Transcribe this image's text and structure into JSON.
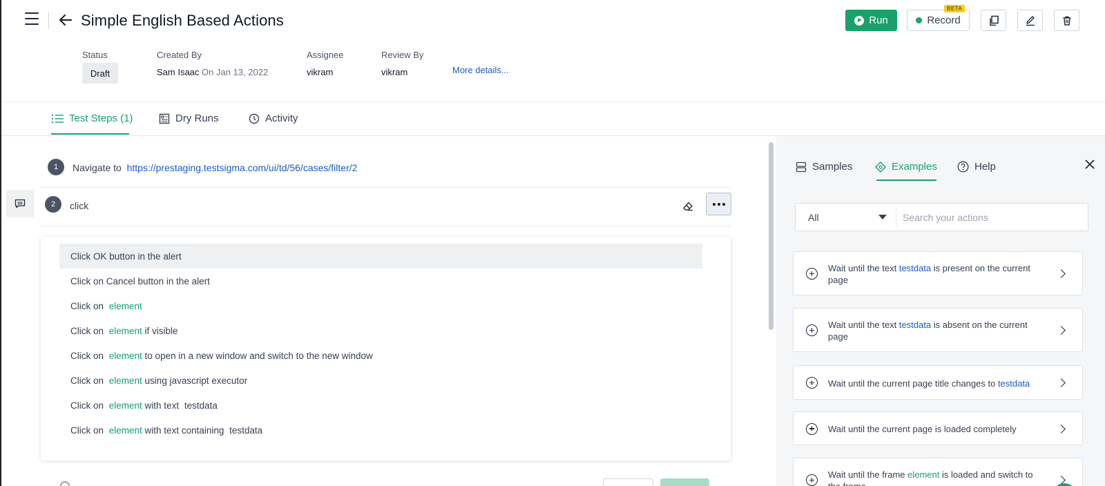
{
  "header": {
    "title": "Simple English Based Actions",
    "run_label": "Run",
    "record_label": "Record",
    "beta_label": "BETA"
  },
  "meta": {
    "status_label": "Status",
    "status_value": "Draft",
    "created_by_label": "Created By",
    "created_by_name": "Sam Isaac",
    "created_on": "On Jan 13, 2022",
    "assignee_label": "Assignee",
    "assignee_value": "vikram",
    "review_by_label": "Review By",
    "review_by_value": "vikram",
    "more_details": "More details..."
  },
  "tabs": [
    {
      "label": "Test Steps (1)",
      "icon": "list-icon",
      "active": true
    },
    {
      "label": "Dry Runs",
      "icon": "report-icon",
      "active": false
    },
    {
      "label": "Activity",
      "icon": "clock-icon",
      "active": false
    }
  ],
  "steps": [
    {
      "number": "1",
      "prefix": "Navigate to",
      "url": "https://prestaging.testsigma.com/ui/td/56/cases/filter/2"
    },
    {
      "number": "2",
      "input_value": "click"
    }
  ],
  "suggestions": [
    {
      "parts": [
        "Click OK button in the alert"
      ],
      "highlighted": true
    },
    {
      "parts": [
        "Click on Cancel button in the alert"
      ]
    },
    {
      "parts": [
        "Click on ",
        "element"
      ]
    },
    {
      "parts": [
        "Click on ",
        "element",
        " if visible"
      ]
    },
    {
      "parts": [
        "Click on ",
        "element",
        " to open in a new window and switch to the new window"
      ]
    },
    {
      "parts": [
        "Click on ",
        "element",
        " using javascript executor"
      ]
    },
    {
      "parts": [
        "Click on ",
        "element",
        " with text ",
        "testdata"
      ]
    },
    {
      "parts": [
        "Click on ",
        "element",
        " with text containing ",
        "testdata"
      ]
    }
  ],
  "right_panel": {
    "tabs": [
      {
        "label": "Samples",
        "icon": "samples-icon",
        "active": false
      },
      {
        "label": "Examples",
        "icon": "examples-icon",
        "active": true
      },
      {
        "label": "Help",
        "icon": "help-icon",
        "active": false
      }
    ],
    "filter_value": "All",
    "search_placeholder": "Search your actions",
    "cards": [
      {
        "line1": "Wait until the text ",
        "kw1": "testdata",
        "line1b": " is present on the current",
        "line2": "page"
      },
      {
        "line1": "Wait until the text ",
        "kw1": "testdata",
        "line1b": " is absent on the current",
        "line2": "page"
      },
      {
        "line1": "Wait until the current page title changes to ",
        "kw1": "testdata",
        "line1b": "",
        "line2": ""
      },
      {
        "line1": "Wait until the current page is loaded completely",
        "kw1": "",
        "line1b": "",
        "line2": ""
      },
      {
        "line1": "Wait until the frame ",
        "kw1": "element",
        "line1b": " is loaded and switch to",
        "line2": "the frame"
      }
    ]
  },
  "colors": {
    "accent": "#1aa06b",
    "link": "#1e5bbf",
    "beta_badge": "#f5cf1d"
  }
}
